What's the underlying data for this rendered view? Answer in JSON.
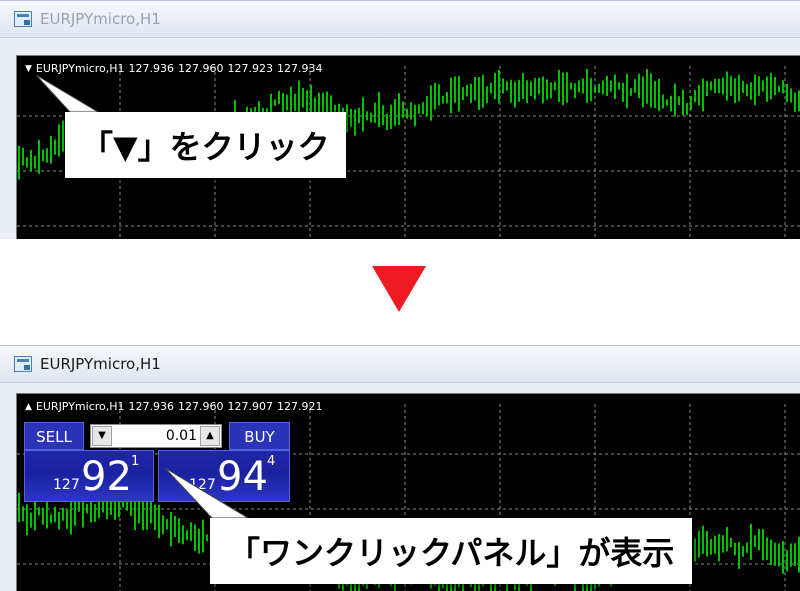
{
  "top_window": {
    "title": "EURJPYmicro,H1",
    "chart_header": {
      "symbol": "EURJPYmicro,H1",
      "open": "127.936",
      "high": "127.960",
      "low": "127.923",
      "close": "127.934"
    },
    "callout": "「▼」をクリック"
  },
  "bottom_window": {
    "title": "EURJPYmicro,H1",
    "chart_header": {
      "symbol": "EURJPYmicro,H1",
      "open": "127.936",
      "high": "127.960",
      "low": "127.907",
      "close": "127.921"
    },
    "one_click_panel": {
      "sell_label": "SELL",
      "buy_label": "BUY",
      "lot_value": "0.01",
      "sell_price": {
        "prefix": "127",
        "main": "92",
        "sup": "1"
      },
      "buy_price": {
        "prefix": "127",
        "main": "94",
        "sup": "4"
      }
    },
    "callout": "「ワンクリックパネル」が表示"
  },
  "colors": {
    "arrow": "#ee1b24",
    "candle": "#00c000",
    "panel_blue": "#2b33b7",
    "chart_bg": "#000000"
  },
  "icons": [
    "window-chart-icon",
    "collapse-triangle-icon",
    "expand-triangle-icon",
    "spin-down-icon",
    "spin-up-icon"
  ]
}
